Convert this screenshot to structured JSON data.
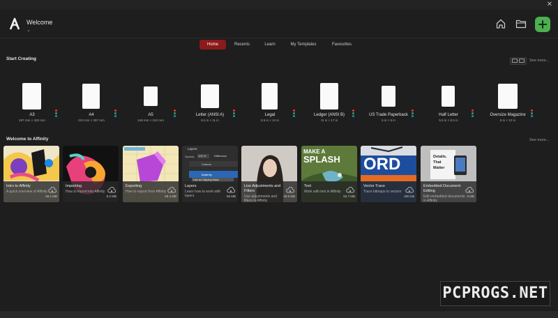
{
  "window": {
    "close_glyph": "✕"
  },
  "header": {
    "title": "Welcome",
    "chevron": "⌄"
  },
  "tabs": [
    "Home",
    "Recents",
    "Learn",
    "My Templates",
    "Favourites"
  ],
  "start_creating": {
    "title": "Start Creating",
    "see_more": "See more...",
    "templates": [
      {
        "name": "A3",
        "size": "297 mm × 420 mm"
      },
      {
        "name": "A4",
        "size": "210 mm × 297 mm"
      },
      {
        "name": "A5",
        "size": "148 mm × 210 mm"
      },
      {
        "name": "Letter (ANSI A)",
        "size": "8.5 in × 11 in"
      },
      {
        "name": "Legal",
        "size": "8.5 in × 14 in"
      },
      {
        "name": "Ledger (ANSI B)",
        "size": "11 in × 17 in"
      },
      {
        "name": "US Trade Paperback",
        "size": "6 in × 9 in"
      },
      {
        "name": "Half Letter",
        "size": "5.5 in × 8.5 in"
      },
      {
        "name": "Oversize Magazine",
        "size": "9 in × 12 in"
      }
    ]
  },
  "welcome_section": {
    "title": "Welcome to Affinity",
    "see_more": "See more...",
    "cards": [
      {
        "title": "Intro to Affinity",
        "desc": "A quick overview of Affinity",
        "size": "59.1 MB"
      },
      {
        "title": "Importing",
        "desc": "How to import into Affinity",
        "size": "8.2 MB"
      },
      {
        "title": "Exporting",
        "desc": "How to export from Affinity",
        "size": "58.4 MB"
      },
      {
        "title": "Layers",
        "desc": "Learn how to work with layers",
        "size": "66 MB"
      },
      {
        "title": "Live Adjustments and Filters",
        "desc": "Use adjustments and filters in Affinity",
        "size": "29.9 MB"
      },
      {
        "title": "Text",
        "desc": "Work with text in Affinity",
        "size": "52.7 MB"
      },
      {
        "title": "Vector Trace",
        "desc": "Trace bitmaps to vectors",
        "size": "400 KB"
      },
      {
        "title": "Embedded Document Editing",
        "desc": "Edit embedded documents in Affinity",
        "size": "8 MB"
      }
    ],
    "thumb_text": {
      "layers_panel": "Layers",
      "opacity": "Opacity",
      "opacity_val": "100 %",
      "blend": "Difference",
      "colours": "Colours",
      "butterfly": "Butterfly",
      "clipping": "Use as Clipping Mask",
      "splash_line1": "MAKE A",
      "splash_line2": "SPLASH",
      "ord": "ORD",
      "details1": "Details.",
      "details2": "That",
      "details3": "Matter"
    }
  },
  "watermark": "PCPROGS.NET",
  "colors": {
    "accent_red": "#8b1a1a",
    "add_green": "#4caf50",
    "background": "#1e1e1e"
  }
}
